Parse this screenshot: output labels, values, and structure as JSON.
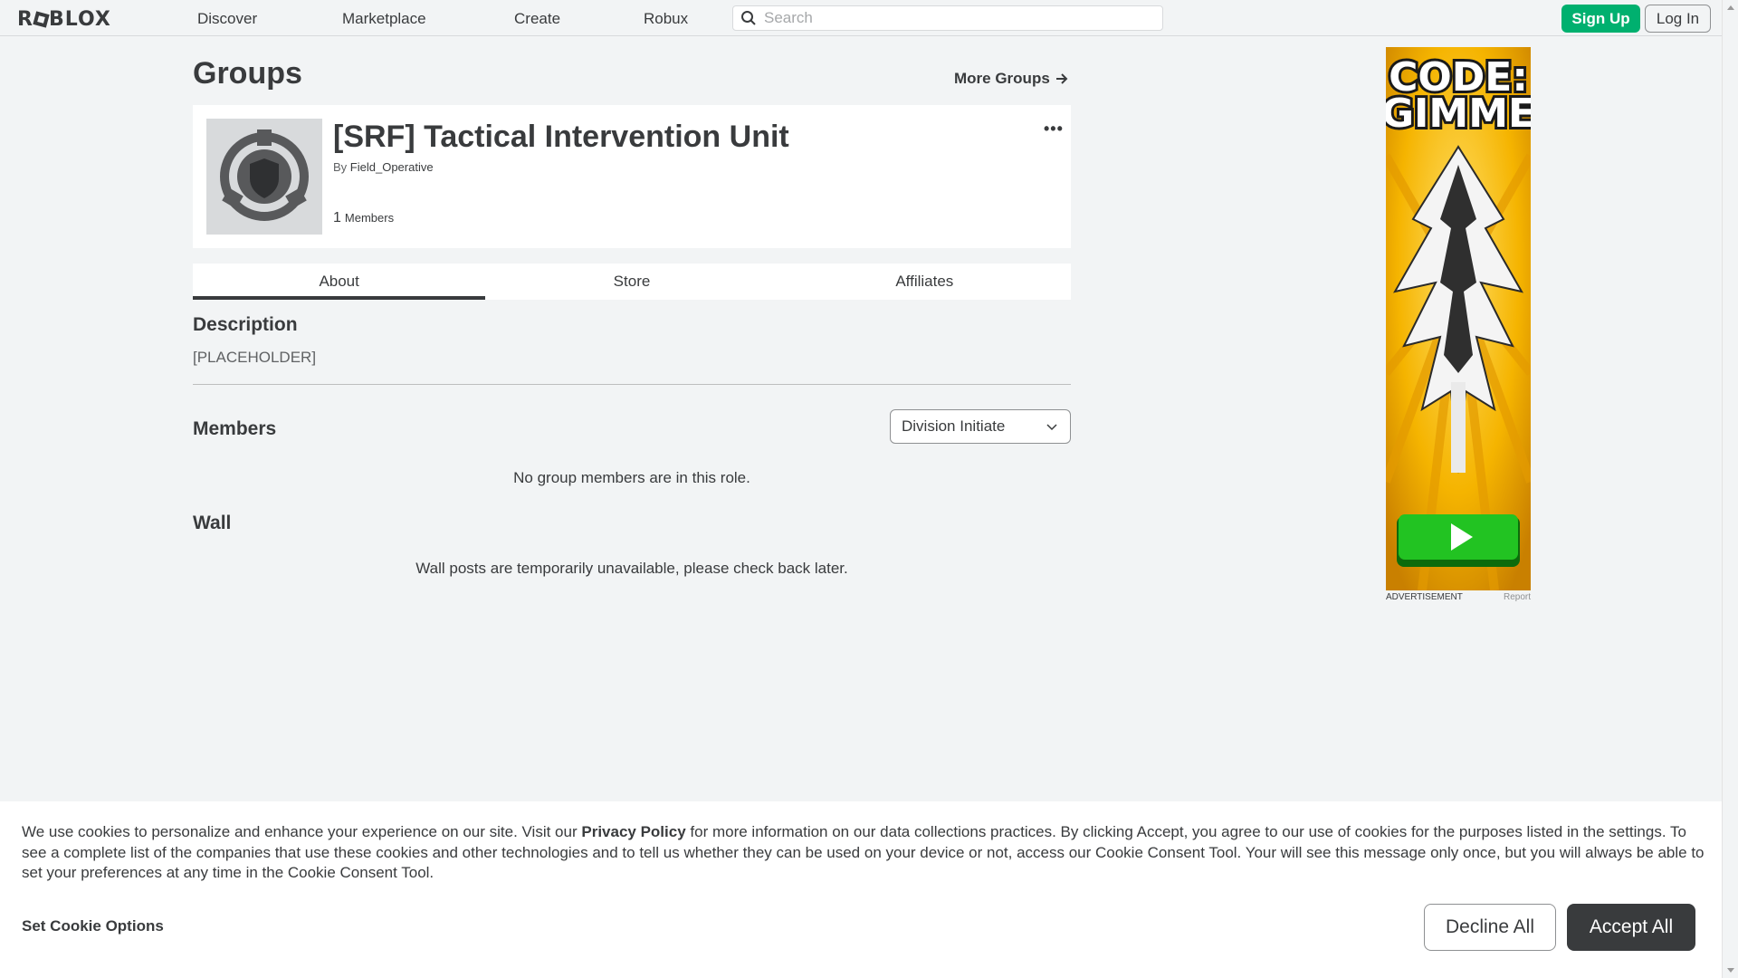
{
  "header": {
    "logo_text_left": "R",
    "logo_text_right": "BLOX",
    "nav": [
      "Discover",
      "Marketplace",
      "Create",
      "Robux"
    ],
    "search_placeholder": "Search",
    "signup_label": "Sign Up",
    "login_label": "Log In"
  },
  "page": {
    "title": "Groups",
    "more_groups_label": "More Groups"
  },
  "group": {
    "name": "[SRF] Tactical Intervention Unit",
    "by_label": "By",
    "owner": "Field_Operative",
    "member_count": "1",
    "members_label": "Members",
    "more_options": "•••"
  },
  "tabs": [
    {
      "label": "About",
      "active": true
    },
    {
      "label": "Store",
      "active": false
    },
    {
      "label": "Affiliates",
      "active": false
    }
  ],
  "about": {
    "description_title": "Description",
    "description_text": "[PLACEHOLDER]",
    "members_title": "Members",
    "role_selected": "Division Initiate",
    "no_members_msg": "No group members are in this role.",
    "wall_title": "Wall",
    "wall_msg": "Wall posts are temporarily unavailable, please check back later."
  },
  "ad": {
    "headline_line1": "CODE:",
    "headline_line2": "GIMME",
    "label": "ADVERTISEMENT",
    "report": "Report"
  },
  "cookie": {
    "text_part1": "We use cookies to personalize and enhance your experience on our site. Visit our ",
    "privacy_link": "Privacy Policy",
    "text_part2": " for more information on our data collections practices. By clicking Accept, you agree to our use of cookies for the purposes listed in the settings. To see a complete list of the companies that use these cookies and other technologies and to tell us whether they can be used on your device or not, access our Cookie Consent Tool. Your will see this message only once, but you will always be able to set your preferences at any time in the Cookie Consent Tool.",
    "options_label": "Set Cookie Options",
    "decline_label": "Decline All",
    "accept_label": "Accept All"
  },
  "colors": {
    "brand_green": "#00b06f",
    "text_dark": "#393b3d",
    "background": "#f2f4f5"
  }
}
